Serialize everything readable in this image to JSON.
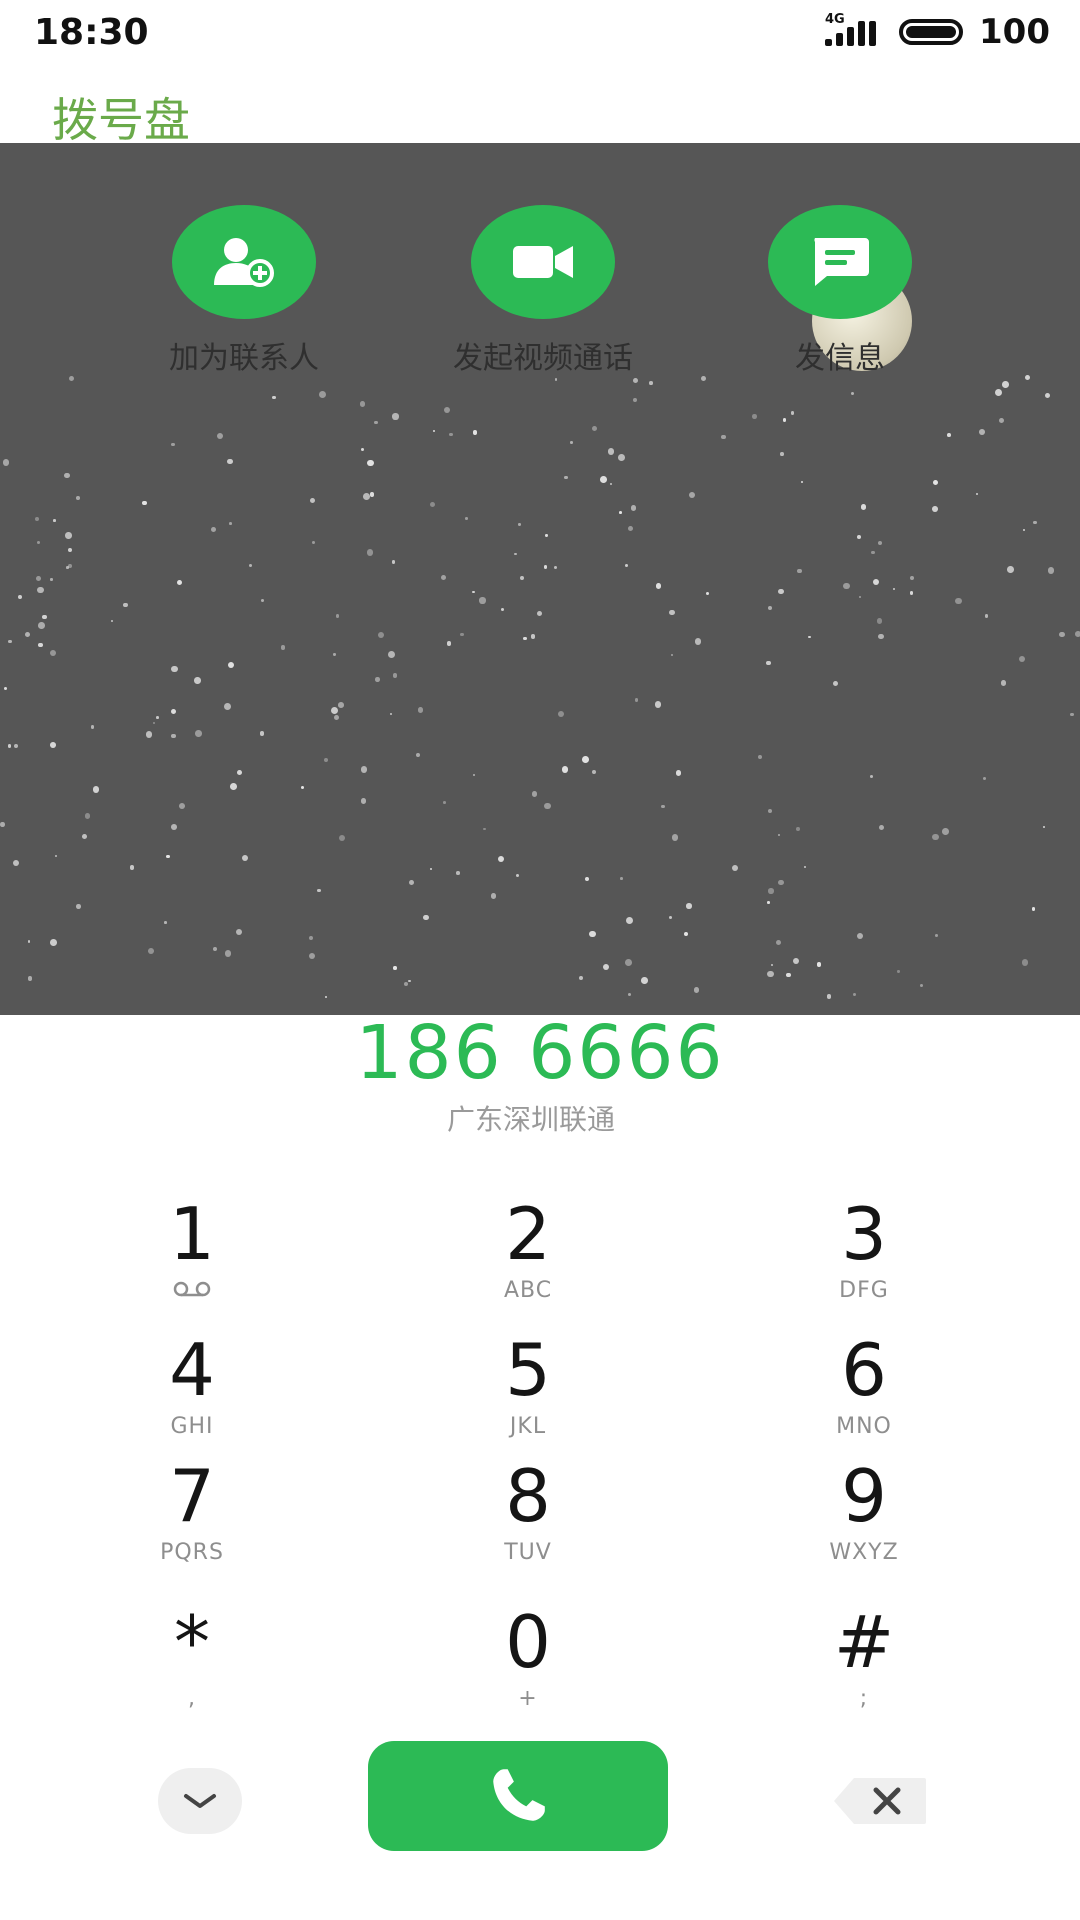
{
  "status": {
    "time": "18:30",
    "network": "4G",
    "battery": "100"
  },
  "header": {
    "title": "拨号盘"
  },
  "actions": [
    {
      "label": "加为联系人",
      "icon": "add-contact-icon"
    },
    {
      "label": "发起视频通话",
      "icon": "video-camera-icon"
    },
    {
      "label": "发信息",
      "icon": "message-icon"
    }
  ],
  "dialer": {
    "number": "186 6666",
    "location": "广东深圳联通"
  },
  "keys": [
    {
      "digit": "1",
      "sub": ""
    },
    {
      "digit": "2",
      "sub": "ABC"
    },
    {
      "digit": "3",
      "sub": "DFG"
    },
    {
      "digit": "4",
      "sub": "GHI"
    },
    {
      "digit": "5",
      "sub": "JKL"
    },
    {
      "digit": "6",
      "sub": "MNO"
    },
    {
      "digit": "7",
      "sub": "PQRS"
    },
    {
      "digit": "8",
      "sub": "TUV"
    },
    {
      "digit": "9",
      "sub": "WXYZ"
    },
    {
      "digit": "*",
      "sub": ","
    },
    {
      "digit": "0",
      "sub": "+"
    },
    {
      "digit": "#",
      "sub": ";"
    }
  ],
  "colors": {
    "accent": "#2cba55",
    "title": "#6aaa4a",
    "wallpaper": "#565656"
  },
  "bottom": {
    "collapse_icon": "chevron-down-icon",
    "call_icon": "phone-icon",
    "delete_icon": "backspace-icon"
  }
}
